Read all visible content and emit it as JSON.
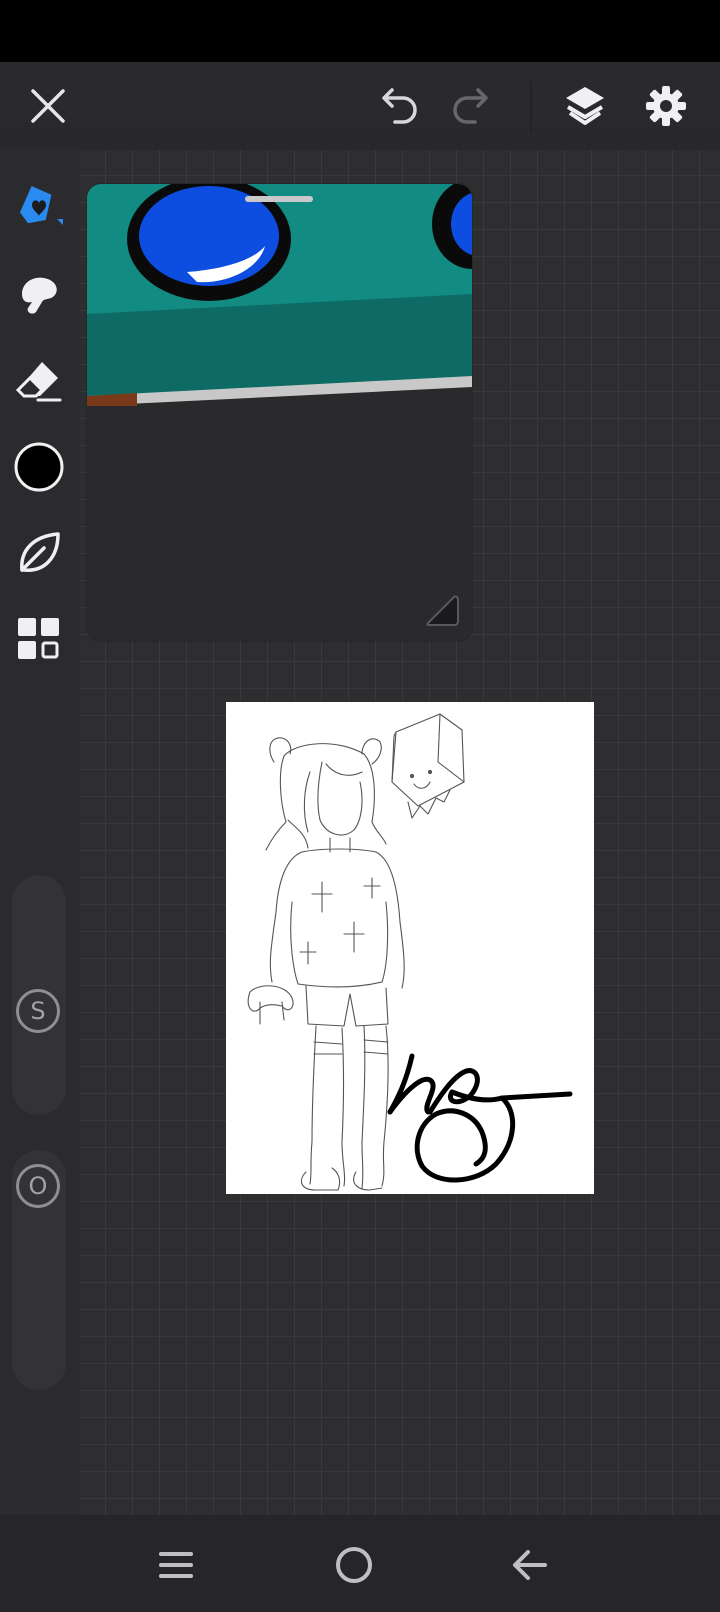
{
  "toolbar": {
    "close_icon": "close-icon",
    "undo_icon": "undo-icon",
    "redo_icon": "redo-icon",
    "layers_icon": "layers-icon",
    "settings_icon": "gear-icon"
  },
  "tools": [
    {
      "name": "brush-tool",
      "icon": "pen-icon",
      "active": true
    },
    {
      "name": "smudge-tool",
      "icon": "smudge-icon",
      "active": false
    },
    {
      "name": "eraser-tool",
      "icon": "eraser-icon",
      "active": false
    },
    {
      "name": "color-tool",
      "icon": "color-swatch-icon",
      "active": false
    },
    {
      "name": "brush-library-tool",
      "icon": "leaf-icon",
      "active": false
    },
    {
      "name": "more-tools",
      "icon": "grid-icon",
      "active": false
    }
  ],
  "colors": {
    "accent": "#2b8af0",
    "current_color": "#000000"
  },
  "sliders": {
    "size_label": "S",
    "opacity_label": "O"
  },
  "navbar": {
    "recents_icon": "recents-icon",
    "home_icon": "home-icon",
    "back_icon": "back-icon"
  }
}
